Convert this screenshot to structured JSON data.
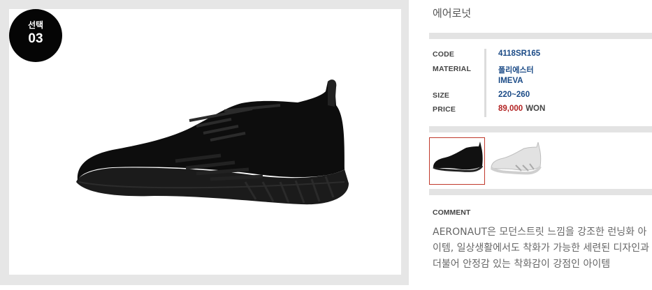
{
  "badge": {
    "line1": "선택",
    "line2": "03"
  },
  "product": {
    "name": "에어로넛",
    "specs": {
      "code_label": "CODE",
      "code": "4118SR165",
      "material_label": "MATERIAL",
      "material_1": "폴리에스터",
      "material_2": "IMEVA",
      "size_label": "SIZE",
      "size": "220~260",
      "price_label": "PRICE",
      "price": "89,000",
      "currency": "WON"
    },
    "thumbnails": [
      {
        "color": "black",
        "selected": true
      },
      {
        "color": "white",
        "selected": false
      }
    ],
    "comment_label": "COMMENT",
    "comment": "AERONAUT은 모던스트릿 느낌을 강조한 런닝화 아이템, 일상생활에서도 착화가 가능한 세련된 디자인과 더불어 안정감 있는 착화감이 강점인 아이템"
  },
  "colors": {
    "frame": "#e6e6e6",
    "bar": "#e3e3e3",
    "accent_blue": "#1a4a86",
    "price_red": "#b22222",
    "thumb_border": "#c0392b"
  }
}
